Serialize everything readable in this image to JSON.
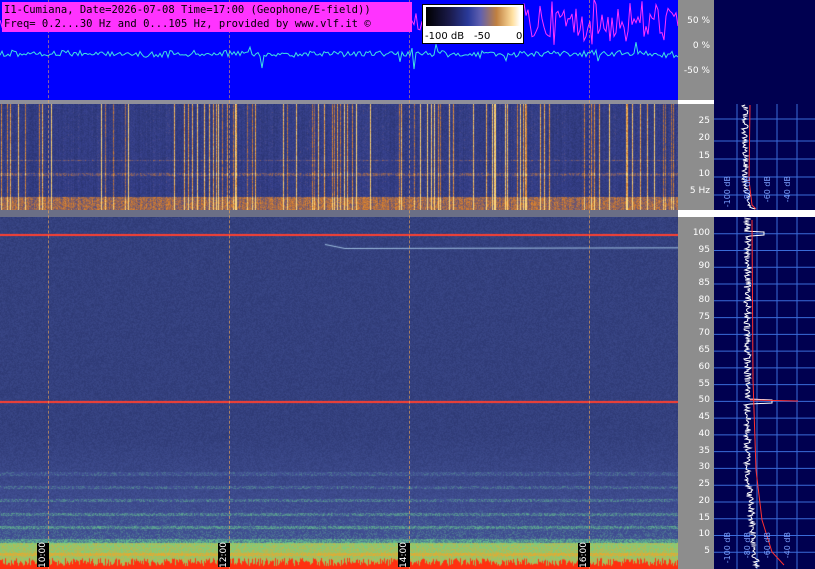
{
  "title": {
    "line1": "I1-Cumiana, Date=2026-07-08 Time=17:00 (Geophone/E-field))",
    "line2": "Freq= 0.2...30 Hz and 0...105 Hz, provided by www.vlf.it ©"
  },
  "legend": {
    "min_label": "-100 dB",
    "mid_label": "-50",
    "max_label": "0"
  },
  "wave_axis": {
    "labels": [
      "50 %",
      "0 %",
      "-50 %"
    ]
  },
  "top_spectrogram_axis": {
    "labels": [
      "25",
      "20",
      "15",
      "10",
      "5 Hz"
    ],
    "values": [
      25,
      20,
      15,
      10,
      5
    ],
    "range_hz": [
      0,
      30
    ]
  },
  "bottom_spectrogram_axis": {
    "labels": [
      "100",
      "95",
      "90",
      "85",
      "80",
      "75",
      "70",
      "65",
      "60",
      "55",
      "50",
      "45",
      "40",
      "35",
      "30",
      "25",
      "20",
      "15",
      "10",
      "5"
    ],
    "values": [
      100,
      95,
      90,
      85,
      80,
      75,
      70,
      65,
      60,
      55,
      50,
      45,
      40,
      35,
      30,
      25,
      20,
      15,
      10,
      5
    ],
    "range_hz": [
      0,
      105
    ]
  },
  "time_markers": [
    "10:00",
    "12:00",
    "14:00",
    "16:00"
  ],
  "right_panel": {
    "top_labels": [
      "-100 dB",
      "-80 dB",
      "-60 dB",
      "-40 dB",
      "-20 dB"
    ],
    "bottom_labels": [
      "-100 dB",
      "-80 dB",
      "-60 dB",
      "-40 dB",
      "-20 dB"
    ]
  },
  "colors": {
    "wave_bg": "#0000ff",
    "title_bg": "#ff33ff",
    "right_panel_bg": "#000050",
    "axis_bg": "#8d8d8d",
    "power_line": "#ff2020"
  }
}
